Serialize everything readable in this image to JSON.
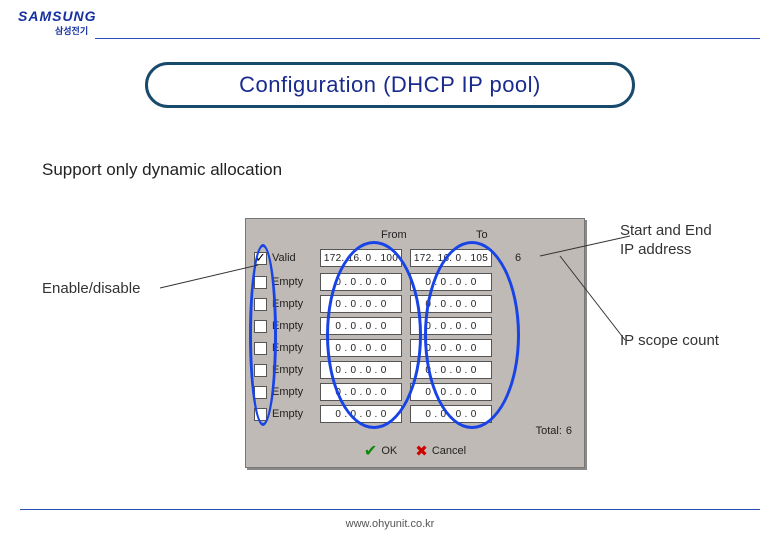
{
  "brand": {
    "name": "SAMSUNG",
    "sub": "삼성전기"
  },
  "title": "Configuration (DHCP IP pool)",
  "subhead": "Support only dynamic allocation",
  "annotations": {
    "enable": "Enable/disable",
    "startend": "Start and End\nIP address",
    "count": "IP scope count"
  },
  "dialog": {
    "col_from": "From",
    "col_to": "To",
    "rows": [
      {
        "checked": true,
        "label": "Valid",
        "from": "172. 16. 0 . 100",
        "to": "172. 16. 0 . 105",
        "count": "6"
      },
      {
        "checked": false,
        "label": "Empty",
        "from": "0 . 0 . 0 . 0",
        "to": "0 . 0 . 0 . 0",
        "count": ""
      },
      {
        "checked": false,
        "label": "Empty",
        "from": "0 . 0 . 0 . 0",
        "to": "0 . 0 . 0 . 0",
        "count": ""
      },
      {
        "checked": false,
        "label": "Empty",
        "from": "0 . 0 . 0 . 0",
        "to": "0 . 0 . 0 . 0",
        "count": ""
      },
      {
        "checked": false,
        "label": "Empty",
        "from": "0 . 0 . 0 . 0",
        "to": "0 . 0 . 0 . 0",
        "count": ""
      },
      {
        "checked": false,
        "label": "Empty",
        "from": "0 . 0 . 0 . 0",
        "to": "0 . 0 . 0 . 0",
        "count": ""
      },
      {
        "checked": false,
        "label": "Empty",
        "from": "0 . 0 . 0 . 0",
        "to": "0 . 0 . 0 . 0",
        "count": ""
      },
      {
        "checked": false,
        "label": "Empty",
        "from": "0 . 0 . 0 . 0",
        "to": "0 . 0 . 0 . 0",
        "count": ""
      }
    ],
    "total_label": "Total:",
    "total_value": "6",
    "ok_label": "OK",
    "cancel_label": "Cancel"
  },
  "footer": "www.ohyunit.co.kr"
}
